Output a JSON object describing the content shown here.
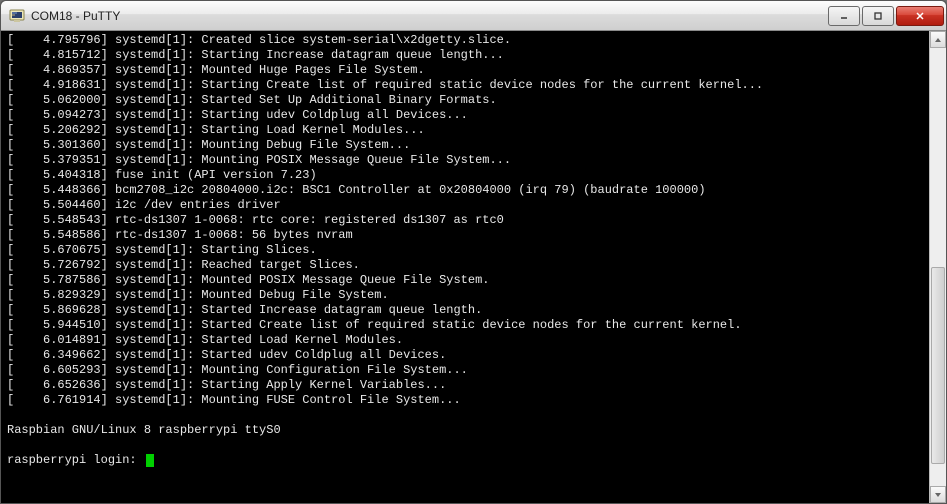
{
  "window": {
    "title": "COM18 - PuTTY"
  },
  "log": [
    "[    4.795796] systemd[1]: Created slice system-serial\\x2dgetty.slice.",
    "[    4.815712] systemd[1]: Starting Increase datagram queue length...",
    "[    4.869357] systemd[1]: Mounted Huge Pages File System.",
    "[    4.918631] systemd[1]: Starting Create list of required static device nodes for the current kernel...",
    "[    5.062000] systemd[1]: Started Set Up Additional Binary Formats.",
    "[    5.094273] systemd[1]: Starting udev Coldplug all Devices...",
    "[    5.206292] systemd[1]: Starting Load Kernel Modules...",
    "[    5.301360] systemd[1]: Mounting Debug File System...",
    "[    5.379351] systemd[1]: Mounting POSIX Message Queue File System...",
    "[    5.404318] fuse init (API version 7.23)",
    "[    5.448366] bcm2708_i2c 20804000.i2c: BSC1 Controller at 0x20804000 (irq 79) (baudrate 100000)",
    "[    5.504460] i2c /dev entries driver",
    "[    5.548543] rtc-ds1307 1-0068: rtc core: registered ds1307 as rtc0",
    "[    5.548586] rtc-ds1307 1-0068: 56 bytes nvram",
    "[    5.670675] systemd[1]: Starting Slices.",
    "[    5.726792] systemd[1]: Reached target Slices.",
    "[    5.787586] systemd[1]: Mounted POSIX Message Queue File System.",
    "[    5.829329] systemd[1]: Mounted Debug File System.",
    "[    5.869628] systemd[1]: Started Increase datagram queue length.",
    "[    5.944510] systemd[1]: Started Create list of required static device nodes for the current kernel.",
    "[    6.014891] systemd[1]: Started Load Kernel Modules.",
    "[    6.349662] systemd[1]: Started udev Coldplug all Devices.",
    "[    6.605293] systemd[1]: Mounting Configuration File System...",
    "[    6.652636] systemd[1]: Starting Apply Kernel Variables...",
    "[    6.761914] systemd[1]: Mounting FUSE Control File System...",
    "",
    "Raspbian GNU/Linux 8 raspberrypi ttyS0",
    ""
  ],
  "prompt": "raspberrypi login: "
}
